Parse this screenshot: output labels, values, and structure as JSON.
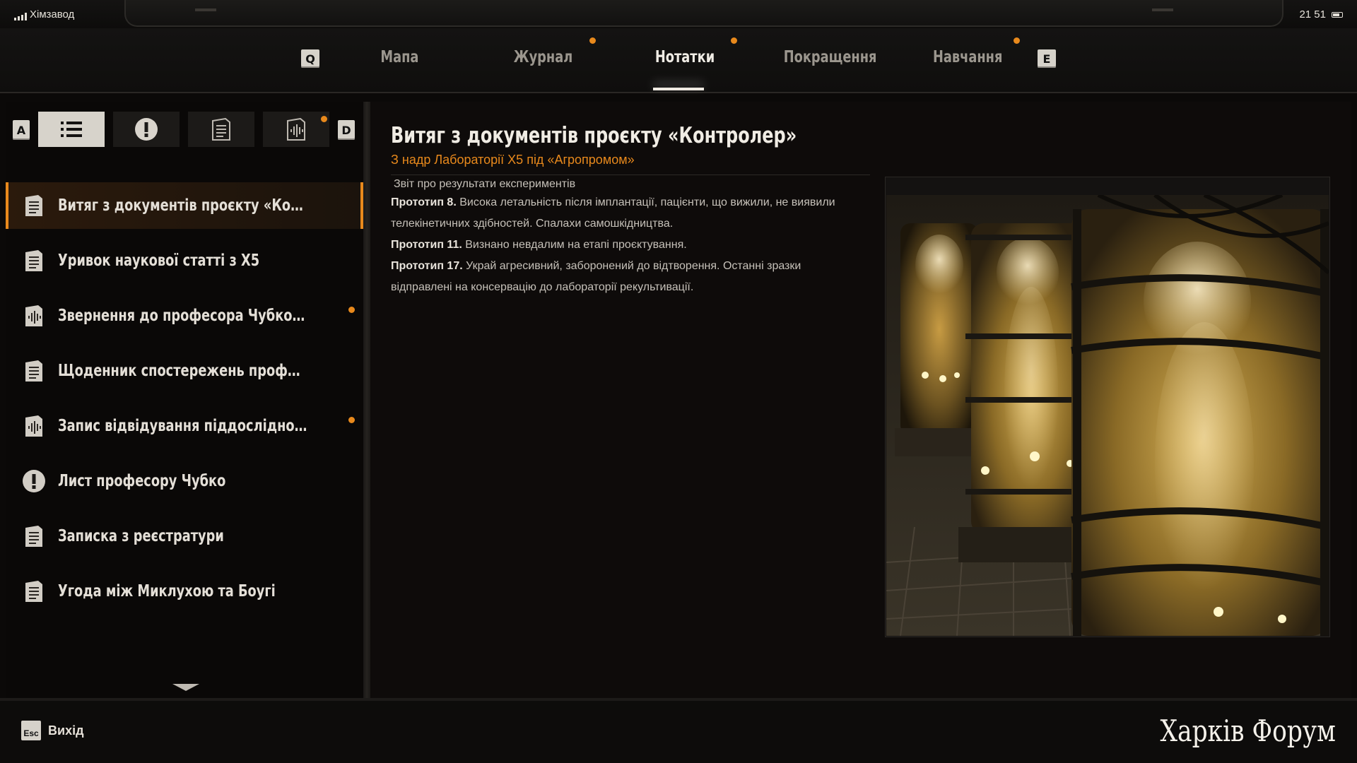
{
  "status_bar": {
    "carrier": "Хімзавод",
    "time": "21 51"
  },
  "tabs": {
    "prev_key": "Q",
    "next_key": "E",
    "items": [
      {
        "label": "Мапа",
        "active": false,
        "notify": false
      },
      {
        "label": "Журнал",
        "active": false,
        "notify": true
      },
      {
        "label": "Нотатки",
        "active": true,
        "notify": true
      },
      {
        "label": "Покращення",
        "active": false,
        "notify": false
      },
      {
        "label": "Навчання",
        "active": false,
        "notify": true
      }
    ]
  },
  "filters": {
    "prev_key": "A",
    "next_key": "D",
    "buttons": [
      {
        "icon": "list-icon",
        "active": true
      },
      {
        "icon": "exclamation-icon",
        "active": false
      },
      {
        "icon": "document-icon",
        "active": false
      },
      {
        "icon": "audio-document-icon",
        "active": false,
        "notify": true
      }
    ]
  },
  "notes": [
    {
      "title": "Витяг з документів проєкту «Контролер»",
      "icon": "document-icon",
      "selected": true,
      "notify": false
    },
    {
      "title": "Уривок наукової статті з X5",
      "icon": "document-icon",
      "selected": false,
      "notify": false
    },
    {
      "title": "Звернення до професора Чубко М.",
      "icon": "audio-document-icon",
      "selected": false,
      "notify": true
    },
    {
      "title": "Щоденник спостережень професора Дву...",
      "icon": "document-icon",
      "selected": false,
      "notify": false
    },
    {
      "title": "Запис відвідування піддослідного, яки...",
      "icon": "audio-document-icon",
      "selected": false,
      "notify": true
    },
    {
      "title": "Лист професору Чубко",
      "icon": "exclamation-icon",
      "selected": false,
      "notify": false
    },
    {
      "title": "Записка з реєстратури",
      "icon": "document-icon",
      "selected": false,
      "notify": false
    },
    {
      "title": "Угода між Миклухою та Боугі",
      "icon": "document-icon",
      "selected": false,
      "notify": false
    }
  ],
  "document": {
    "title": "Витяг з документів проєкту «Контролер»",
    "subtitle": "З надр Лабораторії X5 під «Агропромом»",
    "heading": "Звіт про результати експериментів",
    "entries": [
      {
        "label": "Прототип 8.",
        "text": " Висока летальність після імплантації, пацієнти, що вижили, не виявили телекінетичних здібностей. Спалахи самошкідництва."
      },
      {
        "label": "Прототип 11.",
        "text": " Визнано невдалим на етапі проєктування."
      },
      {
        "label": "Прототип 17.",
        "text": " Украй агресивний, заборонений до відтворення. Останні зразки відправлені на консервацію до лабораторії рекультивації."
      }
    ]
  },
  "bottom": {
    "esc_key": "Esc",
    "exit_label": "Вихід",
    "watermark": "Харків Форум"
  },
  "colors": {
    "accent": "#e8891c",
    "panel": "#0e0b0a",
    "text": "#e4dfd7"
  }
}
